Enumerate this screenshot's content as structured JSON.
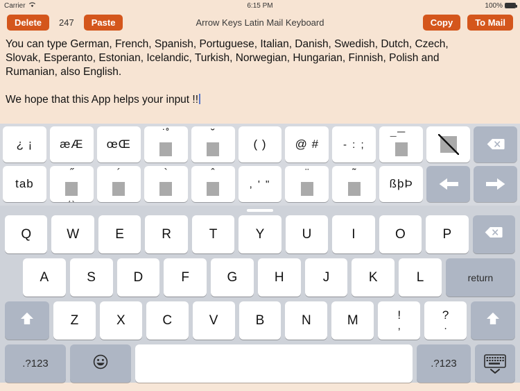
{
  "status_bar": {
    "carrier": "Carrier",
    "wifi_icon": "wifi-icon",
    "time": "6:15 PM",
    "battery_percent": "100%",
    "battery_icon": "battery-full-icon"
  },
  "toolbar": {
    "delete_label": "Delete",
    "counter": "247",
    "paste_label": "Paste",
    "title": "Arrow Keys Latin Mail Keyboard",
    "copy_label": "Copy",
    "to_mail_label": "To Mail",
    "accent_color": "#d4561c"
  },
  "text_area": {
    "line1": "You can type German, French, Spanish, Portuguese, Italian, Danish, Swedish, Dutch, Czech,",
    "line2": "Slovak, Esperanto, Estonian, Icelandic, Turkish, Norwegian, Hungarian, Finnish, Polish and",
    "line3": "Rumanian, also English.",
    "line4": "We hope that this App helps your input !!",
    "background": "#f7e4d3",
    "cursor_color": "#5a78c8"
  },
  "accent_keyboard": {
    "row1": [
      {
        "name": "key-inverted-punctuation",
        "label": "¿ ¡",
        "type": "text"
      },
      {
        "name": "key-ae-ligature",
        "label": "æÆ",
        "type": "text"
      },
      {
        "name": "key-oe-ligature",
        "label": "œŒ",
        "type": "text"
      },
      {
        "name": "key-ring-above-dot",
        "label": "˚˙",
        "type": "dead",
        "mark": "˙˚",
        "below": ""
      },
      {
        "name": "key-breve",
        "label": "˘",
        "type": "dead",
        "mark": "˘",
        "below": ""
      },
      {
        "name": "key-parentheses",
        "label": "( )",
        "type": "text"
      },
      {
        "name": "key-at-hash",
        "label": "@ #",
        "type": "text"
      },
      {
        "name": "key-dash-colon-semicolon",
        "label": "- : ;",
        "type": "text"
      },
      {
        "name": "key-macron",
        "label": "¯",
        "type": "dead",
        "mark": "¯",
        "below": ""
      },
      {
        "name": "key-stroke-slash",
        "label": "/",
        "type": "slash"
      },
      {
        "name": "key-backspace",
        "label": "",
        "type": "backspace",
        "style": "gray"
      }
    ],
    "row2": [
      {
        "name": "key-tab",
        "label": "tab",
        "type": "text"
      },
      {
        "name": "key-double-acute-ogonek",
        "label": "˝",
        "type": "dead",
        "mark": "˝",
        "below": "˛¸"
      },
      {
        "name": "key-acute",
        "label": "´",
        "type": "dead",
        "mark": "´",
        "below": ""
      },
      {
        "name": "key-grave",
        "label": "`",
        "type": "dead",
        "mark": "`",
        "below": ""
      },
      {
        "name": "key-circumflex",
        "label": "ˆ",
        "type": "dead",
        "mark": "ˆ",
        "below": ""
      },
      {
        "name": "key-comma-apostrophe-quote",
        "label": ", ' \"",
        "type": "text"
      },
      {
        "name": "key-diaeresis",
        "label": "¨",
        "type": "dead",
        "mark": "¨",
        "below": ""
      },
      {
        "name": "key-tilde",
        "label": "˜",
        "type": "dead",
        "mark": "˜",
        "below": ""
      },
      {
        "name": "key-eszett-thorn",
        "label": "ßþÞ",
        "type": "text"
      },
      {
        "name": "key-arrow-left",
        "label": "",
        "type": "arrow-left",
        "style": "gray"
      },
      {
        "name": "key-arrow-right",
        "label": "",
        "type": "arrow-right",
        "style": "gray"
      }
    ]
  },
  "system_keyboard": {
    "row1": [
      "Q",
      "W",
      "E",
      "R",
      "T",
      "Y",
      "U",
      "I",
      "O",
      "P"
    ],
    "row1_backspace": "backspace-icon",
    "row2": [
      "A",
      "S",
      "D",
      "F",
      "G",
      "H",
      "J",
      "K",
      "L"
    ],
    "row2_return": "return",
    "row3": [
      "Z",
      "X",
      "C",
      "V",
      "B",
      "N",
      "M"
    ],
    "row3_shift_left": "shift-icon",
    "row3_shift_right": "shift-icon",
    "row3_dual": [
      {
        "top": "!",
        "bottom": ","
      },
      {
        "top": "?",
        "bottom": "."
      }
    ],
    "row4_numbers_left": ".?123",
    "row4_emoji": "😀",
    "row4_space": "",
    "row4_numbers_right": ".?123",
    "row4_dismiss": "hide-keyboard-icon"
  }
}
